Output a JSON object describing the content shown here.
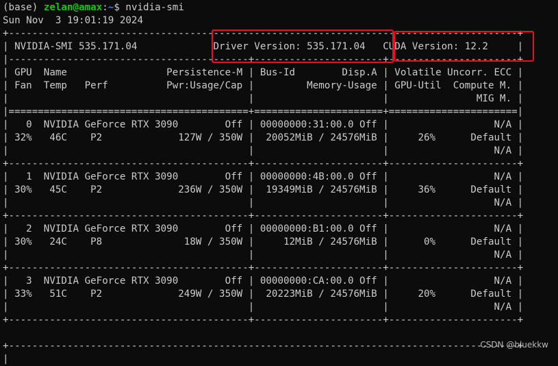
{
  "prompt": {
    "env": "(base) ",
    "user_host": "zelan@amax",
    "colon": ":",
    "cwd": "~",
    "dollar": "$ ",
    "command": "nvidia-smi"
  },
  "timestamp": "Sun Nov  3 19:01:19 2024",
  "header": {
    "border_top": "+---------------------------------------------------------------------------------------+",
    "smi_line": "| NVIDIA-SMI 535.171.04             Driver Version: 535.171.04   CUDA Version: 12.2     |",
    "smi_version_label": "NVIDIA-SMI 535.171.04",
    "driver_version": "Driver Version: 535.171.04",
    "cuda_version": "CUDA Version: 12.2",
    "separator": "|-----------------------------------------+----------------------+----------------------+",
    "col_row1": "| GPU  Name                 Persistence-M | Bus-Id        Disp.A | Volatile Uncorr. ECC |",
    "col_row2": "| Fan  Temp   Perf          Pwr:Usage/Cap |         Memory-Usage | GPU-Util  Compute M. |",
    "col_row3": "|                                         |                      |               MIG M. |",
    "double_sep": "|=========================================+======================+======================|"
  },
  "gpus": [
    {
      "index": "0",
      "name": "NVIDIA GeForce RTX 3090",
      "persistence": "Off",
      "bus_id": "00000000:31:00.0",
      "disp": "Off",
      "ecc": "N/A",
      "fan": "32%",
      "temp": "46C",
      "perf": "P2",
      "power": "127W / 350W",
      "memory": "20052MiB / 24576MiB",
      "util": "26%",
      "compute": "Default",
      "mig": "N/A",
      "line1": "|   0  NVIDIA GeForce RTX 3090        Off | 00000000:31:00.0 Off |                  N/A |",
      "line2": "| 32%   46C    P2             127W / 350W |  20052MiB / 24576MiB |     26%      Default |",
      "line3": "|                                         |                      |                  N/A |"
    },
    {
      "index": "1",
      "name": "NVIDIA GeForce RTX 3090",
      "persistence": "Off",
      "bus_id": "00000000:4B:00.0",
      "disp": "Off",
      "ecc": "N/A",
      "fan": "30%",
      "temp": "45C",
      "perf": "P2",
      "power": "236W / 350W",
      "memory": "19349MiB / 24576MiB",
      "util": "36%",
      "compute": "Default",
      "mig": "N/A",
      "line1": "|   1  NVIDIA GeForce RTX 3090        Off | 00000000:4B:00.0 Off |                  N/A |",
      "line2": "| 30%   45C    P2             236W / 350W |  19349MiB / 24576MiB |     36%      Default |",
      "line3": "|                                         |                      |                  N/A |"
    },
    {
      "index": "2",
      "name": "NVIDIA GeForce RTX 3090",
      "persistence": "Off",
      "bus_id": "00000000:B1:00.0",
      "disp": "Off",
      "ecc": "N/A",
      "fan": "30%",
      "temp": "24C",
      "perf": "P8",
      "power": "18W / 350W",
      "memory": "12MiB / 24576MiB",
      "util": "0%",
      "compute": "Default",
      "mig": "N/A",
      "line1": "|   2  NVIDIA GeForce RTX 3090        Off | 00000000:B1:00.0 Off |                  N/A |",
      "line2": "| 30%   24C    P8              18W / 350W |     12MiB / 24576MiB |      0%      Default |",
      "line3": "|                                         |                      |                  N/A |"
    },
    {
      "index": "3",
      "name": "NVIDIA GeForce RTX 3090",
      "persistence": "Off",
      "bus_id": "00000000:CA:00.0",
      "disp": "Off",
      "ecc": "N/A",
      "fan": "33%",
      "temp": "51C",
      "perf": "P2",
      "power": "249W / 350W",
      "memory": "20223MiB / 24576MiB",
      "util": "20%",
      "compute": "Default",
      "mig": "N/A",
      "line1": "|   3  NVIDIA GeForce RTX 3090        Off | 00000000:CA:00.0 Off |                  N/A |",
      "line2": "| 33%   51C    P2             249W / 350W |  20223MiB / 24576MiB |     20%      Default |",
      "line3": "|                                         |                      |                  N/A |"
    }
  ],
  "gpu_separator": "+-----------------------------------------+----------------------+----------------------+",
  "blank_line": "",
  "process_border": "+---------------------------------------------------------------------------------------+",
  "process_partial": "|",
  "highlight_color": "#e81123",
  "watermark": "CSDN @bluekkw"
}
